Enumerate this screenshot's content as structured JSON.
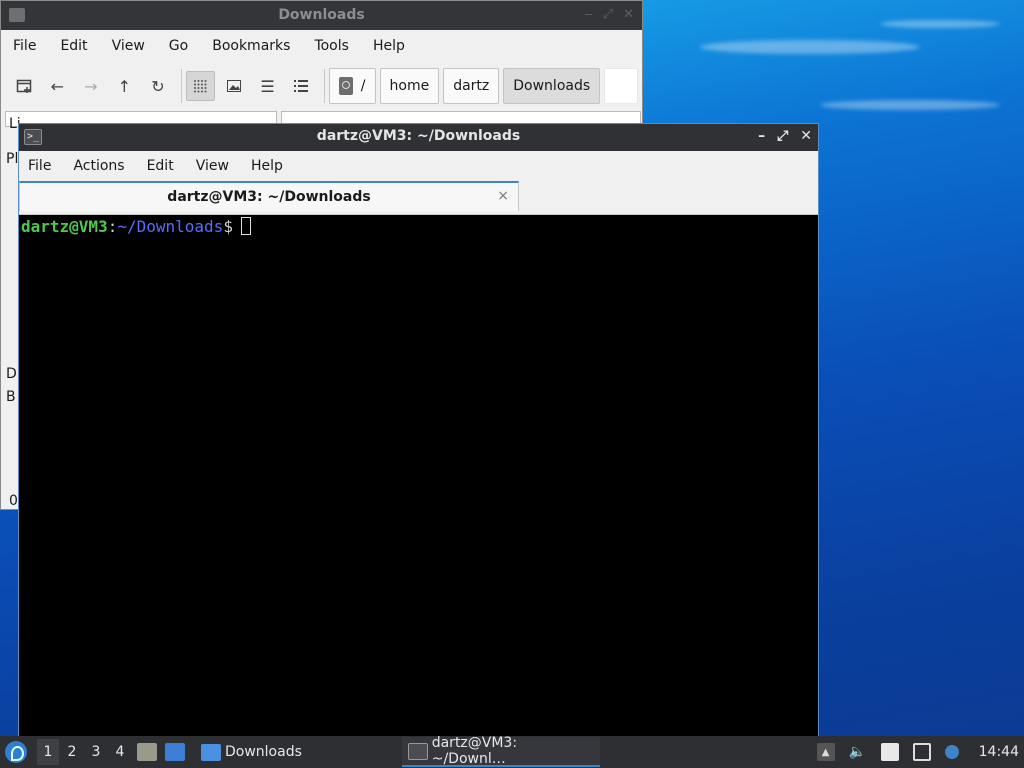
{
  "file_manager": {
    "title": "Downloads",
    "menu": [
      "File",
      "Edit",
      "View",
      "Go",
      "Bookmarks",
      "Tools",
      "Help"
    ],
    "breadcrumbs": {
      "root": "/",
      "items": [
        "home",
        "dartz",
        "Downloads"
      ]
    },
    "side_partial": [
      "Li",
      "Pl",
      "D",
      "B",
      "0"
    ]
  },
  "terminal": {
    "title": "dartz@VM3: ~/Downloads",
    "menu": [
      "File",
      "Actions",
      "Edit",
      "View",
      "Help"
    ],
    "tab_label": "dartz@VM3: ~/Downloads",
    "tab_close": "×",
    "prompt": {
      "user_host": "dartz@VM3",
      "colon": ":",
      "path": "~/Downloads",
      "dollar": "$"
    }
  },
  "taskbar": {
    "workspaces": [
      "1",
      "2",
      "3",
      "4"
    ],
    "tasks": [
      {
        "label": "Downloads",
        "icon": "folder-icon"
      },
      {
        "label": "dartz@VM3: ~/Downl…",
        "icon": "terminal-icon"
      }
    ],
    "clock": "14:44"
  },
  "colors": {
    "accent": "#3d84c6",
    "prompt_user": "#4ec94e",
    "prompt_path": "#5b6bff",
    "titlebar": "#2f3135"
  }
}
